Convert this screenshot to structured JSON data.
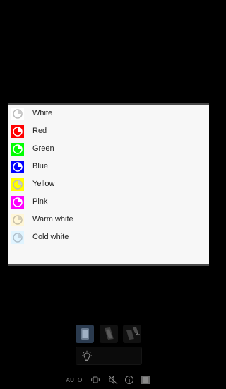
{
  "background_ui": {
    "mode_buttons": [
      {
        "icon": "phone-screen-icon",
        "active": true
      },
      {
        "icon": "phone-dim-icon",
        "active": false
      },
      {
        "icon": "phone-switch-icon",
        "active": false
      }
    ],
    "light_row_icon": "bulb-icon"
  },
  "color_dialog": {
    "items": [
      {
        "label": "White",
        "color": "#ffffff"
      },
      {
        "label": "Red",
        "color": "#ff0000"
      },
      {
        "label": "Green",
        "color": "#00ff00"
      },
      {
        "label": "Blue",
        "color": "#0000ff"
      },
      {
        "label": "Yellow",
        "color": "#ffff00"
      },
      {
        "label": "Pink",
        "color": "#ff00ff"
      },
      {
        "label": "Warm white",
        "color": "#fff6d6"
      },
      {
        "label": "Cold white",
        "color": "#e0f4ff"
      }
    ]
  },
  "bottom_bar": {
    "auto_label": "AUTO",
    "icons": [
      "rotate-icon",
      "mute-icon",
      "info-icon",
      "square-icon"
    ]
  }
}
